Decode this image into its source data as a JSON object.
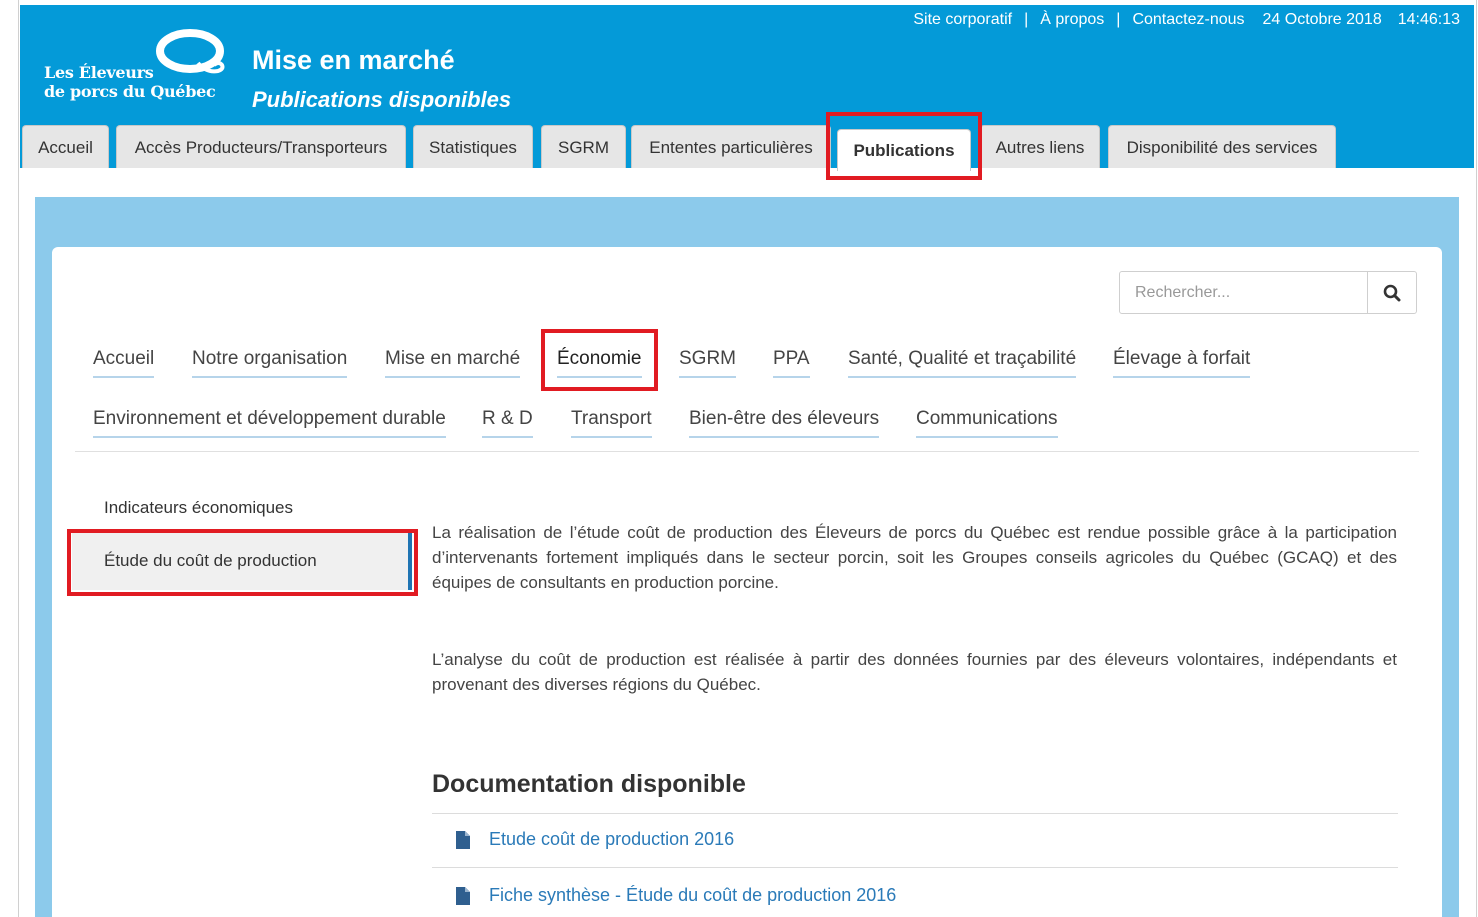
{
  "brand": {
    "logo_line1": "Les Éleveurs",
    "logo_line2": "de porcs du Québec"
  },
  "header": {
    "title": "Mise en marché",
    "subtitle": "Publications disponibles"
  },
  "top_links": {
    "site": "Site corporatif",
    "sep": "|",
    "about": "À propos",
    "contact": "Contactez-nous",
    "date": "24 Octobre 2018",
    "time": "14:46:13"
  },
  "main_tabs": [
    {
      "label": "Accueil"
    },
    {
      "label": "Accès Producteurs/Transporteurs"
    },
    {
      "label": "Statistiques"
    },
    {
      "label": "SGRM"
    },
    {
      "label": "Ententes particulières"
    },
    {
      "label": "Publications",
      "active": true
    },
    {
      "label": "Autres liens"
    },
    {
      "label": "Disponibilité des services"
    }
  ],
  "search": {
    "placeholder": "Rechercher..."
  },
  "subnav": [
    {
      "label": "Accueil"
    },
    {
      "label": "Notre organisation"
    },
    {
      "label": "Mise en marché"
    },
    {
      "label": "Économie",
      "active": true
    },
    {
      "label": "SGRM"
    },
    {
      "label": "PPA"
    },
    {
      "label": "Santé, Qualité et traçabilité"
    },
    {
      "label": "Élevage à forfait"
    },
    {
      "label": "Environnement et développement durable"
    },
    {
      "label": "R & D"
    },
    {
      "label": "Transport"
    },
    {
      "label": "Bien-être des éleveurs"
    },
    {
      "label": "Communications"
    }
  ],
  "sidebar": [
    {
      "label": "Indicateurs économiques"
    },
    {
      "label": "Étude du coût de production",
      "active": true
    }
  ],
  "content": {
    "paragraph1": "La réalisation de l’étude coût de production des Éleveurs de porcs du Québec est rendue possible grâce à la participation d’intervenants fortement impliqués dans le secteur porcin, soit les Groupes conseils agricoles du Québec (GCAQ) et des équipes de consultants en production porcine.",
    "paragraph2": "L’analyse du coût de production est réalisée à partir des données fournies par des éleveurs volontaires, indépendants et provenant des diverses régions du Québec.",
    "doc_heading": "Documentation disponible",
    "documents": [
      {
        "label": "Etude coût de production 2016",
        "icon": "file-icon"
      },
      {
        "label": "Fiche synthèse - Étude du coût de production 2016",
        "icon": "file-icon"
      }
    ]
  },
  "colors": {
    "header": "#049ad8",
    "panel": "#8ccaeb",
    "highlight": "#e11b22",
    "link": "#2a7ab8"
  }
}
